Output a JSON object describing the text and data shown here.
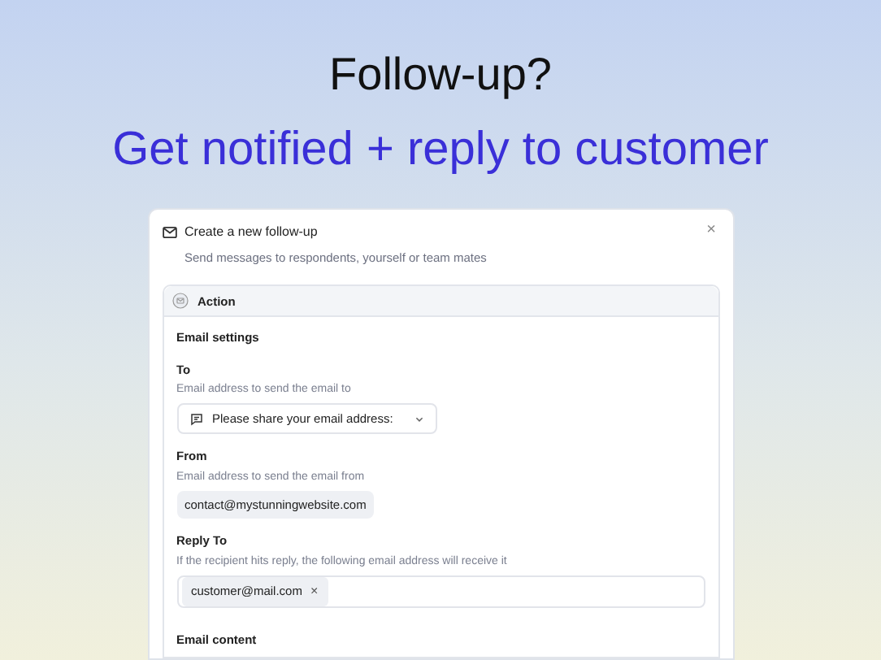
{
  "headline": "Follow-up?",
  "subheadline": "Get notified + reply to customer",
  "dialog": {
    "title": "Create a new follow-up",
    "subtitle": "Send messages to respondents, yourself or team mates",
    "close": "×",
    "panel": {
      "title": "Action",
      "section": "Email settings",
      "fields": [
        {
          "kind": "select",
          "label": "To",
          "hint": "Email address to send the email to",
          "value": "Please share your email address:"
        },
        {
          "kind": "chip",
          "label": "From",
          "hint": "Email address to send the email from",
          "value": "contact@mystunningwebsite.com"
        },
        {
          "kind": "tags",
          "label": "Reply To",
          "hint": "If the recipient hits reply, the following email address will receive it",
          "tags": [
            {
              "text": "customer@mail.com",
              "remove": "×"
            }
          ]
        }
      ],
      "section_2": "Email content"
    }
  }
}
